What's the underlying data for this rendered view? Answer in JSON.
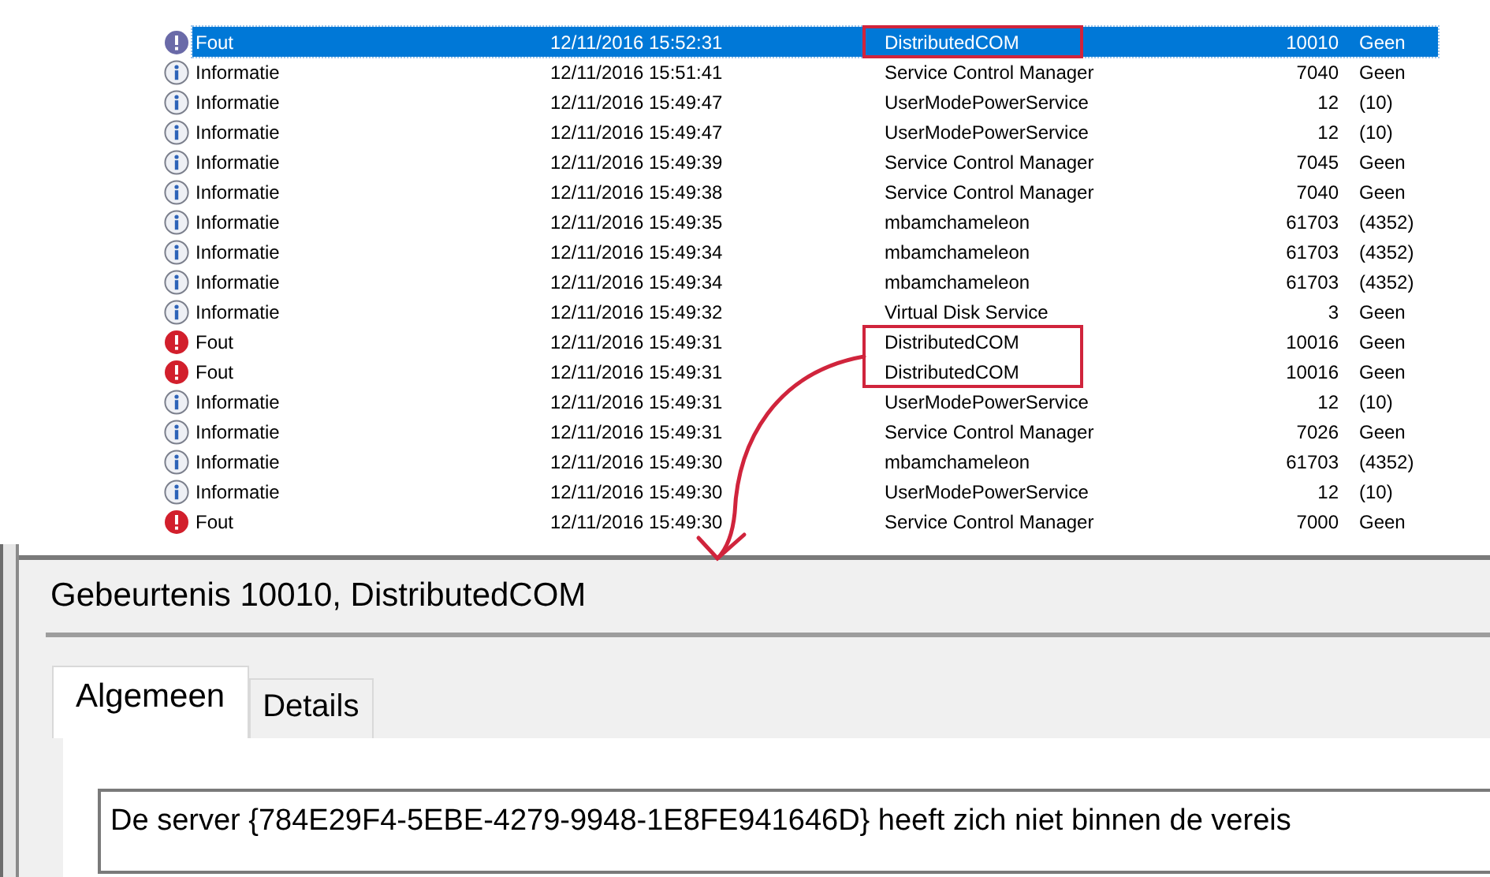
{
  "events": {
    "rows": [
      {
        "kind": "error",
        "level": "Fout",
        "date": "12/11/2016 15:52:31",
        "source": "DistributedCOM",
        "event_id": "10010",
        "task_category": "Geen",
        "selected": true,
        "marked": true
      },
      {
        "kind": "info",
        "level": "Informatie",
        "date": "12/11/2016 15:51:41",
        "source": "Service Control Manager",
        "event_id": "7040",
        "task_category": "Geen",
        "selected": false,
        "marked": false
      },
      {
        "kind": "info",
        "level": "Informatie",
        "date": "12/11/2016 15:49:47",
        "source": "UserModePowerService",
        "event_id": "12",
        "task_category": "(10)",
        "selected": false,
        "marked": false
      },
      {
        "kind": "info",
        "level": "Informatie",
        "date": "12/11/2016 15:49:47",
        "source": "UserModePowerService",
        "event_id": "12",
        "task_category": "(10)",
        "selected": false,
        "marked": false
      },
      {
        "kind": "info",
        "level": "Informatie",
        "date": "12/11/2016 15:49:39",
        "source": "Service Control Manager",
        "event_id": "7045",
        "task_category": "Geen",
        "selected": false,
        "marked": false
      },
      {
        "kind": "info",
        "level": "Informatie",
        "date": "12/11/2016 15:49:38",
        "source": "Service Control Manager",
        "event_id": "7040",
        "task_category": "Geen",
        "selected": false,
        "marked": false
      },
      {
        "kind": "info",
        "level": "Informatie",
        "date": "12/11/2016 15:49:35",
        "source": "mbamchameleon",
        "event_id": "61703",
        "task_category": "(4352)",
        "selected": false,
        "marked": false
      },
      {
        "kind": "info",
        "level": "Informatie",
        "date": "12/11/2016 15:49:34",
        "source": "mbamchameleon",
        "event_id": "61703",
        "task_category": "(4352)",
        "selected": false,
        "marked": false
      },
      {
        "kind": "info",
        "level": "Informatie",
        "date": "12/11/2016 15:49:34",
        "source": "mbamchameleon",
        "event_id": "61703",
        "task_category": "(4352)",
        "selected": false,
        "marked": false
      },
      {
        "kind": "info",
        "level": "Informatie",
        "date": "12/11/2016 15:49:32",
        "source": "Virtual Disk Service",
        "event_id": "3",
        "task_category": "Geen",
        "selected": false,
        "marked": false
      },
      {
        "kind": "error",
        "level": "Fout",
        "date": "12/11/2016 15:49:31",
        "source": "DistributedCOM",
        "event_id": "10016",
        "task_category": "Geen",
        "selected": false,
        "marked": true
      },
      {
        "kind": "error",
        "level": "Fout",
        "date": "12/11/2016 15:49:31",
        "source": "DistributedCOM",
        "event_id": "10016",
        "task_category": "Geen",
        "selected": false,
        "marked": true
      },
      {
        "kind": "info",
        "level": "Informatie",
        "date": "12/11/2016 15:49:31",
        "source": "UserModePowerService",
        "event_id": "12",
        "task_category": "(10)",
        "selected": false,
        "marked": false
      },
      {
        "kind": "info",
        "level": "Informatie",
        "date": "12/11/2016 15:49:31",
        "source": "Service Control Manager",
        "event_id": "7026",
        "task_category": "Geen",
        "selected": false,
        "marked": false
      },
      {
        "kind": "info",
        "level": "Informatie",
        "date": "12/11/2016 15:49:30",
        "source": "mbamchameleon",
        "event_id": "61703",
        "task_category": "(4352)",
        "selected": false,
        "marked": false
      },
      {
        "kind": "info",
        "level": "Informatie",
        "date": "12/11/2016 15:49:30",
        "source": "UserModePowerService",
        "event_id": "12",
        "task_category": "(10)",
        "selected": false,
        "marked": false
      },
      {
        "kind": "error",
        "level": "Fout",
        "date": "12/11/2016 15:49:30",
        "source": "Service Control Manager",
        "event_id": "7000",
        "task_category": "Geen",
        "selected": false,
        "marked": false
      }
    ]
  },
  "dialog": {
    "title": "Gebeurtenis 10010, DistributedCOM",
    "tabs": [
      {
        "label": "Algemeen",
        "selected": true
      },
      {
        "label": "Details",
        "selected": false
      }
    ],
    "message": "De server {784E29F4-5EBE-4279-9948-1E8FE941646D} heeft zich niet binnen de vereis"
  }
}
